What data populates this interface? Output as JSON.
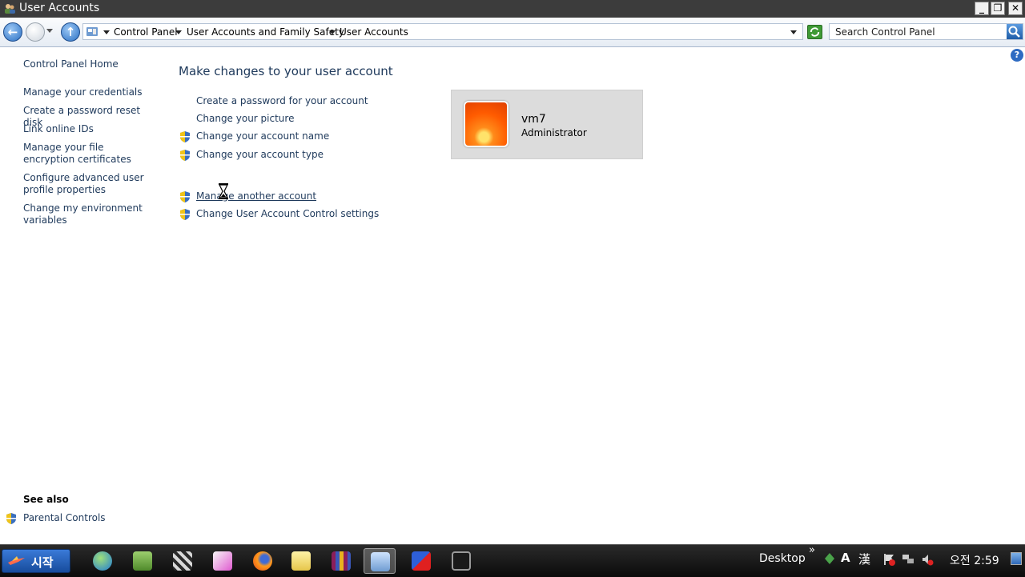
{
  "window": {
    "title": "User Accounts"
  },
  "address": {
    "crumbs": [
      "Control Panel",
      "User Accounts and Family Safety",
      "User Accounts"
    ],
    "search_placeholder": "Search Control Panel"
  },
  "leftnav": {
    "home": "Control Panel Home",
    "items": [
      "Manage your credentials",
      "Create a password reset disk",
      "Link online IDs",
      "Manage your file encryption certificates",
      "Configure advanced user profile properties",
      "Change my environment variables"
    ],
    "see_also_heading": "See also",
    "see_also_items": [
      "Parental Controls"
    ]
  },
  "main": {
    "heading": "Make changes to your user account",
    "tasks": [
      "Create a password for your account",
      "Change your picture",
      "Change your account name",
      "Change your account type"
    ],
    "other_tasks": [
      "Manage another account",
      "Change User Account Control settings"
    ]
  },
  "user": {
    "name": "vm7",
    "role": "Administrator"
  },
  "taskbar": {
    "start_label": "시작",
    "desktop_label": "Desktop",
    "tray_chevron": "»",
    "ime_a": "A",
    "ime_han": "漢",
    "clock": "오전 2:59"
  }
}
